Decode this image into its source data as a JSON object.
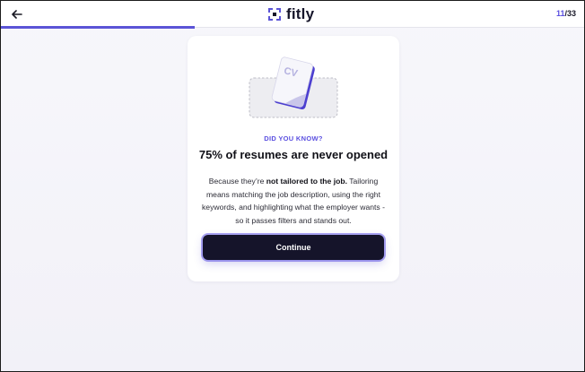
{
  "header": {
    "back_icon": "arrow-left-icon",
    "logo_icon": "fitly-mark-icon",
    "logo_text": "fitly",
    "step_current": "11",
    "step_total": "/33",
    "progress_fraction": 0.333,
    "accent_color": "#5b54d6"
  },
  "card": {
    "illustration_icon": "cv-document-icon",
    "illustration_label": "CV",
    "eyebrow": "DID YOU KNOW?",
    "headline": "75% of resumes are never opened",
    "body_prefix": "Because they’re ",
    "body_bold": "not tailored to the job.",
    "body_suffix": " Tailoring means matching the job description, using the right keywords, and highlighting what the employer wants - so it passes filters and stands out.",
    "cta_label": "Continue"
  }
}
